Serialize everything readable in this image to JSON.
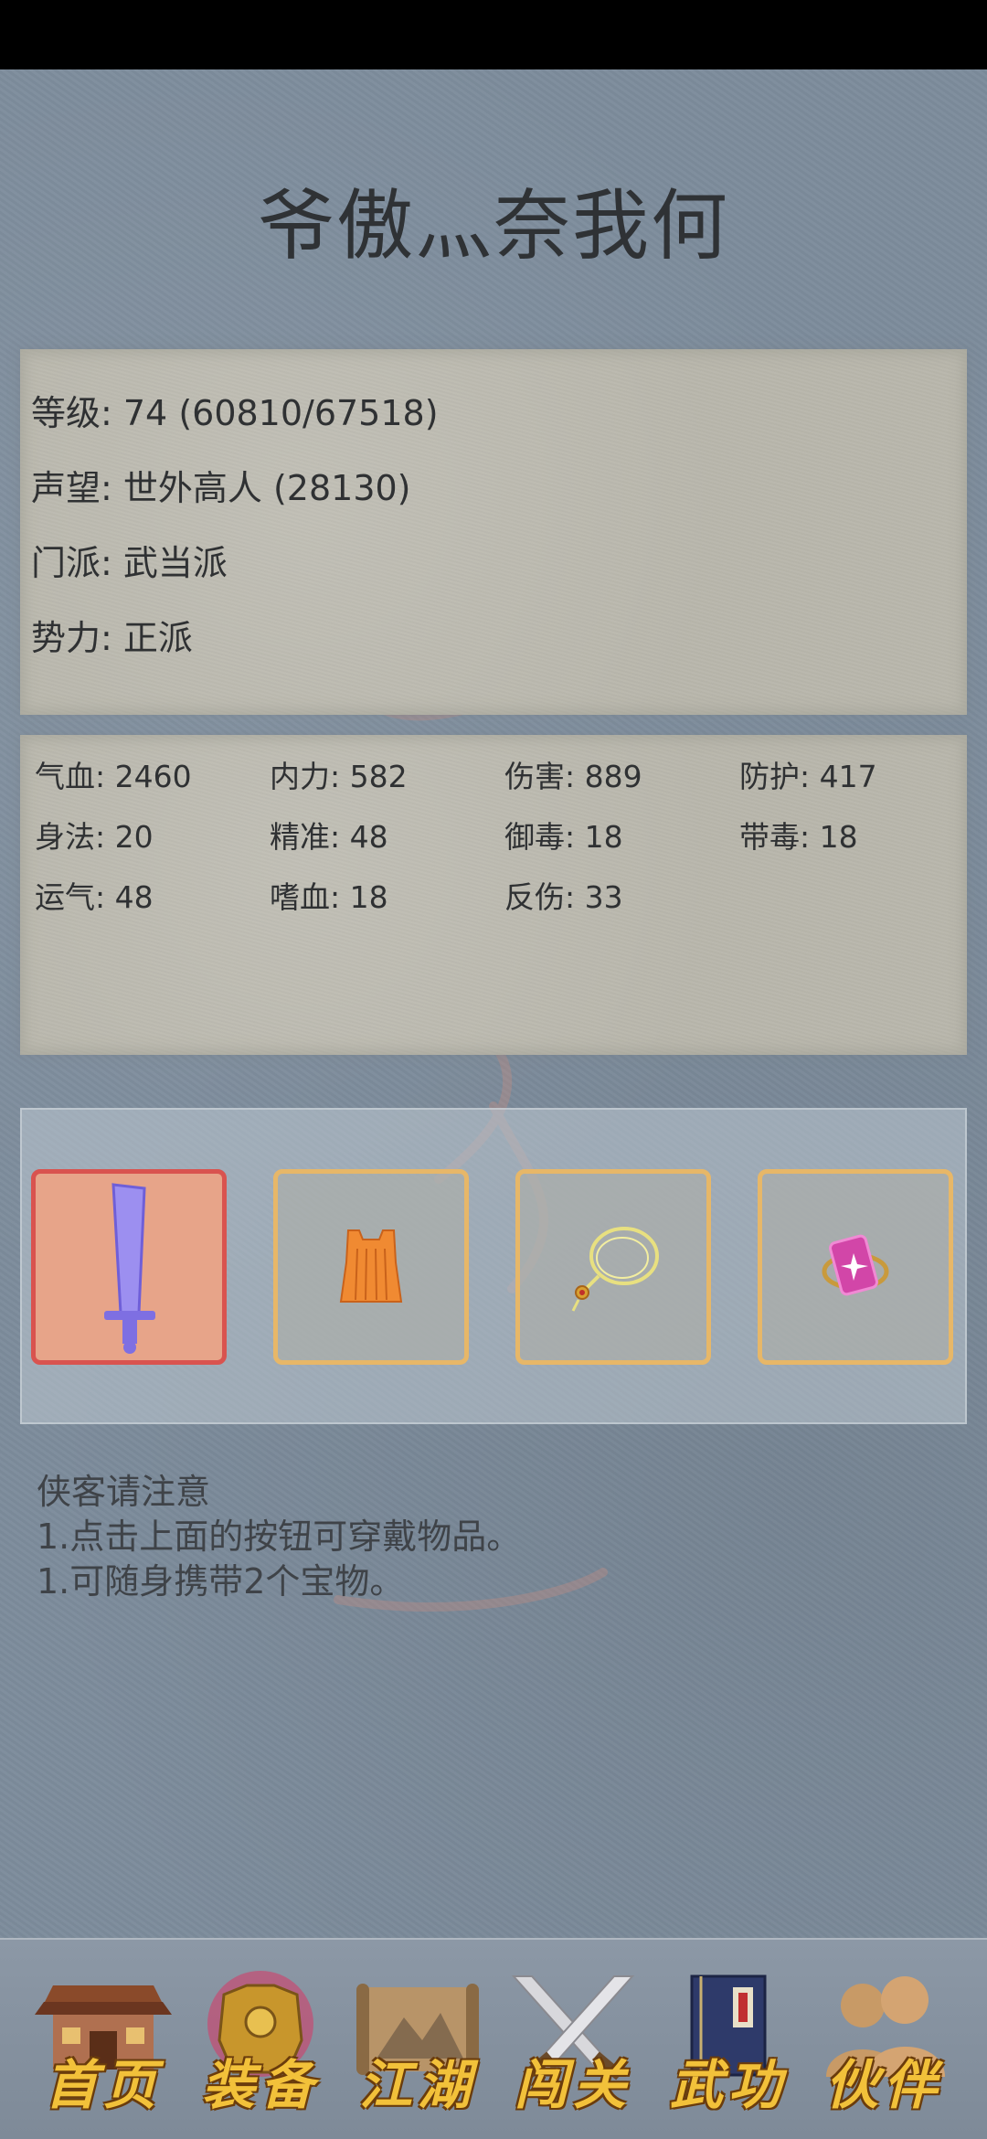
{
  "title": "爷傲灬奈我何",
  "info": {
    "level": "等级: 74 (60810/67518)",
    "reputation": "声望: 世外高人 (28130)",
    "sect": "门派: 武当派",
    "faction": "势力:  正派"
  },
  "stats": [
    "气血: 2460",
    "内力: 582",
    "伤害: 889",
    "防护: 417",
    "身法: 20",
    "精准: 48",
    "御毒: 18",
    "带毒: 18",
    "运气: 48",
    "嗜血: 18",
    "反伤: 33"
  ],
  "equipment": [
    {
      "icon": "sword-icon",
      "selected": true
    },
    {
      "icon": "armor-vest-icon",
      "selected": false
    },
    {
      "icon": "necklace-icon",
      "selected": false
    },
    {
      "icon": "gem-ring-icon",
      "selected": false
    }
  ],
  "notes": {
    "heading": "侠客请注意",
    "line1": "1.点击上面的按钮可穿戴物品。",
    "line2": "1.可随身携带2个宝物。"
  },
  "nav": [
    {
      "label": "首页",
      "icon": "house-icon"
    },
    {
      "label": "装备",
      "icon": "armor-icon"
    },
    {
      "label": "江湖",
      "icon": "scroll-map-icon"
    },
    {
      "label": "闯关",
      "icon": "crossed-swords-icon"
    },
    {
      "label": "武功",
      "icon": "book-icon"
    },
    {
      "label": "伙伴",
      "icon": "companions-icon"
    }
  ],
  "colors": {
    "accent_gold": "#f2c13a",
    "slot_border": "#e7b768",
    "slot_selected": "#d9534f"
  }
}
